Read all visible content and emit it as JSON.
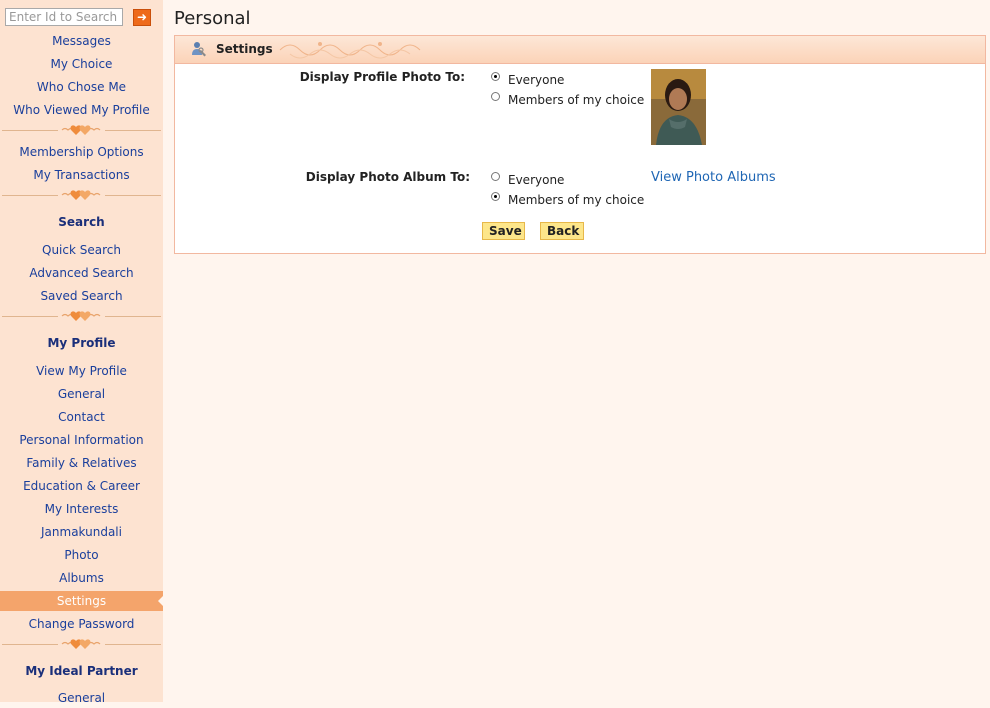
{
  "search": {
    "placeholder": "Enter Id to Search",
    "go_icon": "arrow-right-icon"
  },
  "sidebar": {
    "items_top": [
      "Messages",
      "My Choice",
      "Who Chose Me",
      "Who Viewed My Profile"
    ],
    "items_membership": [
      "Membership Options",
      "My Transactions"
    ],
    "search_heading": "Search",
    "items_search": [
      "Quick Search",
      "Advanced Search",
      "Saved Search"
    ],
    "profile_heading": "My Profile",
    "items_profile": [
      "View My Profile",
      "General",
      "Contact",
      "Personal Information",
      "Family & Relatives",
      "Education & Career",
      "My Interests",
      "Janmakundali",
      "Photo",
      "Albums",
      "Settings",
      "Change Password"
    ],
    "active_item": "Settings",
    "partner_heading": "My Ideal Partner",
    "items_partner": [
      "General"
    ]
  },
  "page": {
    "title": "Personal",
    "panel_title": "Settings",
    "profile_photo_label": "Display Profile Photo To:",
    "profile_photo_options": [
      "Everyone",
      "Members of my choice"
    ],
    "profile_photo_selected": 0,
    "album_label": "Display Photo Album To:",
    "album_options": [
      "Everyone",
      "Members of my choice"
    ],
    "album_selected": 1,
    "view_albums_link": "View Photo Albums",
    "save_label": "Save",
    "back_label": "Back"
  },
  "colors": {
    "sidebar_bg": "#fde3d1",
    "active_bg": "#f4a46b",
    "link": "#1f66b4",
    "nav_text": "#1a3f9c"
  }
}
